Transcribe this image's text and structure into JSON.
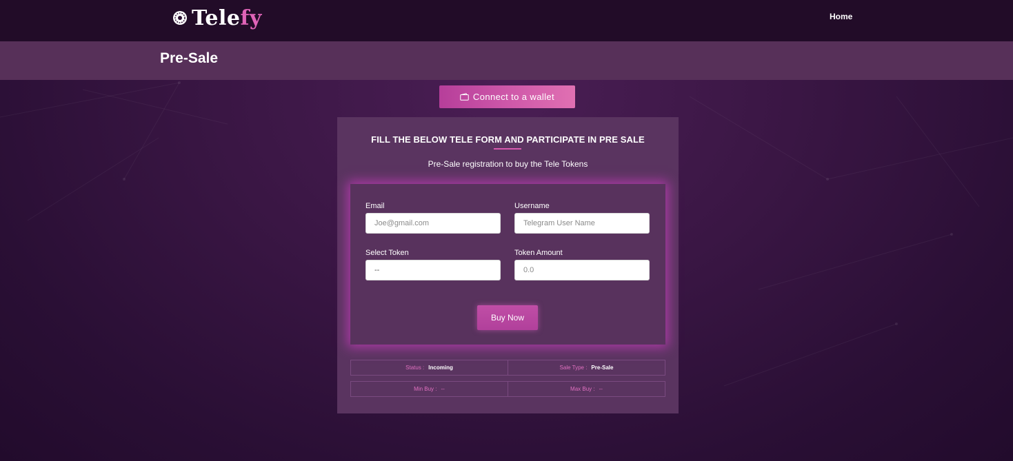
{
  "nav": {
    "logo_text_1": "Tele",
    "logo_text_2": "fy",
    "home_label": "Home"
  },
  "page": {
    "title": "Pre-Sale"
  },
  "wallet": {
    "button_label": "Connect to a wallet"
  },
  "form": {
    "heading": "FILL THE BELOW TELE FORM AND PARTICIPATE IN PRE SALE",
    "subheading": "Pre-Sale registration to buy the Tele Tokens",
    "email": {
      "label": "Email",
      "placeholder": "Joe@gmail.com",
      "value": ""
    },
    "username": {
      "label": "Username",
      "placeholder": "Telegram User Name",
      "value": ""
    },
    "token": {
      "label": "Select Token",
      "value": "--"
    },
    "amount": {
      "label": "Token Amount",
      "placeholder": "0.0",
      "value": ""
    },
    "buy_label": "Buy Now"
  },
  "sale_info": {
    "status_label": "Status :",
    "status_value": "Incoming",
    "sale_type_label": "Sale Type :",
    "sale_type_value": "Pre-Sale",
    "min_buy_label": "Min Buy :",
    "min_buy_value": "--",
    "max_buy_label": "Max Buy :",
    "max_buy_value": "--"
  },
  "colors": {
    "accent": "#d05aaa",
    "nav_bg": "#220c28",
    "titlebar_bg": "#573059",
    "card_bg": "#5a3460"
  }
}
